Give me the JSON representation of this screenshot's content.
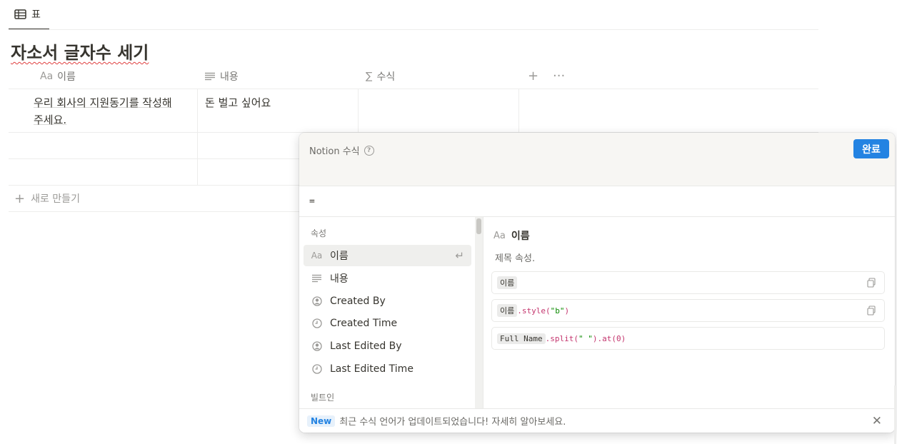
{
  "view_tab": {
    "label": "표",
    "icon": "table-icon"
  },
  "database": {
    "title": "자소서 글자수 세기"
  },
  "table": {
    "columns": [
      {
        "icon": "Aa",
        "label": "이름"
      },
      {
        "icon": "text-icon",
        "label": "내용"
      },
      {
        "icon": "∑",
        "label": "수식"
      }
    ],
    "rows": [
      {
        "name_line1": "우리 회사의 지원동기를 작성해",
        "name_line2": "주세요.",
        "content": "돈 벌고 싶어요"
      },
      {
        "name_line1": "",
        "name_line2": "",
        "content": ""
      },
      {
        "name_line1": "",
        "name_line2": "",
        "content": ""
      }
    ],
    "new_row_label": "새로 만들기"
  },
  "formula_popup": {
    "title": "Notion 수식",
    "done_label": "완료",
    "formula_value": "=",
    "properties_section": "속성",
    "builtins_section": "빌트인",
    "properties": [
      {
        "icon": "Aa",
        "label": "이름"
      },
      {
        "icon": "text-icon",
        "label": "내용"
      },
      {
        "icon": "person-icon",
        "label": "Created By"
      },
      {
        "icon": "clock-icon",
        "label": "Created Time"
      },
      {
        "icon": "person-icon",
        "label": "Last Edited By"
      },
      {
        "icon": "clock-icon",
        "label": "Last Edited Time"
      }
    ],
    "detail": {
      "icon": "Aa",
      "title": "이름",
      "description": "제목 속성.",
      "examples": [
        {
          "chip": "이름",
          "code": ""
        },
        {
          "chip": "이름",
          "fn": ".style(",
          "str": "\"b\"",
          "end": ")"
        },
        {
          "chip": "Full Name",
          "fn": ".split(",
          "str": "\" \"",
          "mid": ").at(",
          "num": "0",
          "end": ")"
        }
      ]
    },
    "footer": {
      "badge": "New",
      "message": "최근 수식 언어가 업데이트되었습니다! 자세히 알아보세요."
    }
  },
  "colors": {
    "accent": "#2383e2",
    "text": "#37352f",
    "muted": "#9b9a97",
    "code_fn": "#c4366e",
    "code_str": "#0b8a00"
  }
}
